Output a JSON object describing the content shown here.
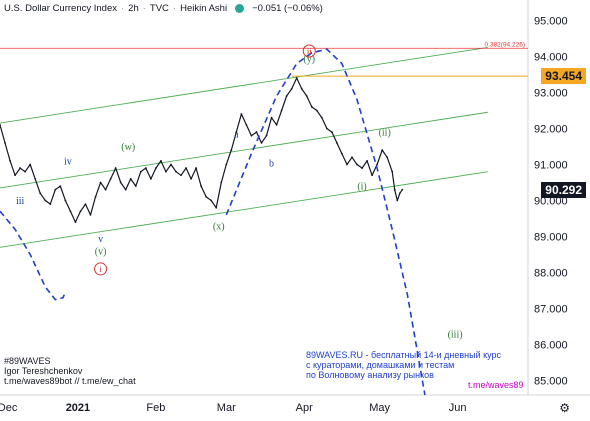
{
  "header": {
    "symbol": "U.S. Dollar Currency Index",
    "interval": "2h",
    "exchange": "TVC",
    "chart_style": "Heikin Ashi",
    "change": "−0.051 (−0.06%)"
  },
  "colors": {
    "candle": "#131722",
    "channel": "#4caf50",
    "forecast": "#1e3fcf",
    "fib_line": "#e53935",
    "level_line": "#f5a623",
    "current_badge": "#131722",
    "level_badge": "#f5a623",
    "wave_green": "#2e7d32",
    "wave_blue": "#1a3ea8",
    "wave_red": "#d32f2f",
    "promo_text": "#1e3fcf",
    "link_magenta": "#c400c4"
  },
  "chart_data": {
    "type": "line",
    "title": "U.S. Dollar Currency Index",
    "ylim": [
      84.6,
      95.4
    ],
    "y_ticks": [
      85.0,
      86.0,
      87.0,
      88.0,
      89.0,
      90.0,
      91.0,
      92.0,
      93.0,
      94.0,
      95.0
    ],
    "y_tick_labels": [
      "85.000",
      "86.000",
      "87.000",
      "88.000",
      "89.000",
      "90.000",
      "91.000",
      "92.000",
      "93.000",
      "94.000",
      "95.000"
    ],
    "x_ticks": [
      {
        "label": "Dec",
        "day": 3
      },
      {
        "label": "2021",
        "day": 31
      },
      {
        "label": "Feb",
        "day": 62
      },
      {
        "label": "Mar",
        "day": 90
      },
      {
        "label": "Apr",
        "day": 121
      },
      {
        "label": "May",
        "day": 151
      },
      {
        "label": "Jun",
        "day": 182
      }
    ],
    "xlim_days": [
      0,
      210
    ],
    "price_series": [
      [
        0,
        92.1
      ],
      [
        2,
        91.6
      ],
      [
        4,
        91.1
      ],
      [
        6,
        90.7
      ],
      [
        8,
        90.9
      ],
      [
        10,
        90.8
      ],
      [
        12,
        91.0
      ],
      [
        14,
        90.6
      ],
      [
        16,
        90.2
      ],
      [
        18,
        90.0
      ],
      [
        20,
        89.9
      ],
      [
        22,
        90.3
      ],
      [
        24,
        90.4
      ],
      [
        26,
        90.0
      ],
      [
        28,
        89.7
      ],
      [
        30,
        89.4
      ],
      [
        32,
        89.7
      ],
      [
        34,
        89.9
      ],
      [
        36,
        89.6
      ],
      [
        38,
        90.1
      ],
      [
        40,
        90.5
      ],
      [
        42,
        90.3
      ],
      [
        44,
        90.6
      ],
      [
        46,
        90.9
      ],
      [
        48,
        90.5
      ],
      [
        50,
        90.3
      ],
      [
        52,
        90.6
      ],
      [
        54,
        90.4
      ],
      [
        56,
        90.8
      ],
      [
        58,
        90.9
      ],
      [
        60,
        90.6
      ],
      [
        62,
        90.9
      ],
      [
        64,
        91.1
      ],
      [
        66,
        90.8
      ],
      [
        68,
        91.0
      ],
      [
        70,
        90.8
      ],
      [
        72,
        90.7
      ],
      [
        74,
        90.9
      ],
      [
        76,
        90.6
      ],
      [
        78,
        90.9
      ],
      [
        80,
        90.4
      ],
      [
        82,
        90.1
      ],
      [
        84,
        90.0
      ],
      [
        86,
        89.8
      ],
      [
        88,
        90.5
      ],
      [
        90,
        91.0
      ],
      [
        92,
        91.4
      ],
      [
        94,
        91.9
      ],
      [
        96,
        92.4
      ],
      [
        98,
        92.1
      ],
      [
        100,
        91.8
      ],
      [
        102,
        91.9
      ],
      [
        104,
        91.6
      ],
      [
        106,
        91.8
      ],
      [
        108,
        92.3
      ],
      [
        110,
        92.1
      ],
      [
        112,
        92.5
      ],
      [
        114,
        92.9
      ],
      [
        116,
        93.1
      ],
      [
        118,
        93.4
      ],
      [
        120,
        93.1
      ],
      [
        122,
        92.9
      ],
      [
        124,
        92.6
      ],
      [
        126,
        92.5
      ],
      [
        128,
        92.3
      ],
      [
        130,
        92.0
      ],
      [
        132,
        91.9
      ],
      [
        134,
        91.6
      ],
      [
        136,
        91.3
      ],
      [
        138,
        91.0
      ],
      [
        140,
        91.2
      ],
      [
        142,
        91.0
      ],
      [
        144,
        90.9
      ],
      [
        146,
        91.1
      ],
      [
        148,
        90.7
      ],
      [
        150,
        91.0
      ],
      [
        152,
        91.4
      ],
      [
        154,
        91.2
      ],
      [
        156,
        90.8
      ],
      [
        157,
        90.3
      ],
      [
        158,
        90.0
      ],
      [
        159,
        90.2
      ],
      [
        160,
        90.3
      ]
    ],
    "channel_lines": [
      {
        "d1": 0,
        "p1": 92.15,
        "d2": 194,
        "p2": 94.25
      },
      {
        "d1": 0,
        "p1": 88.7,
        "d2": 194,
        "p2": 90.8
      },
      {
        "d1": 0,
        "p1": 90.35,
        "d2": 194,
        "p2": 92.45
      }
    ],
    "fib_level": {
      "label": "0.382(94.226)",
      "value": 94.226
    },
    "horizontal_level": {
      "value": 93.454,
      "start_day": 116
    },
    "current_price": 90.292,
    "forecast_paths": [
      [
        [
          0,
          89.7
        ],
        [
          6,
          89.2
        ],
        [
          12,
          88.5
        ],
        [
          18,
          87.6
        ],
        [
          22,
          87.25
        ],
        [
          25,
          87.3
        ],
        [
          26,
          87.45
        ]
      ],
      [
        [
          90,
          89.6
        ],
        [
          100,
          91.3
        ],
        [
          110,
          92.9
        ],
        [
          118,
          93.8
        ],
        [
          124,
          94.1
        ],
        [
          130,
          94.2
        ],
        [
          136,
          93.8
        ],
        [
          142,
          92.8
        ],
        [
          150,
          90.9
        ],
        [
          156,
          89.2
        ],
        [
          162,
          87.4
        ],
        [
          166,
          85.8
        ],
        [
          169,
          84.6
        ]
      ]
    ],
    "wave_labels": [
      {
        "text": "iii",
        "day": 8,
        "price": 89.9,
        "color": "blue"
      },
      {
        "text": "iv",
        "day": 27,
        "price": 91.0,
        "color": "blue"
      },
      {
        "text": "(w)",
        "day": 51,
        "price": 91.4,
        "color": "green"
      },
      {
        "text": "v",
        "day": 40,
        "price": 88.85,
        "color": "blue"
      },
      {
        "text": "(v)",
        "day": 40,
        "price": 88.5,
        "color": "green"
      },
      {
        "text": "(x)",
        "day": 87,
        "price": 89.2,
        "color": "green"
      },
      {
        "text": "a",
        "day": 94,
        "price": 91.75,
        "color": "blue"
      },
      {
        "text": "b",
        "day": 108,
        "price": 90.95,
        "color": "blue"
      },
      {
        "text": "(y)",
        "day": 123,
        "price": 93.85,
        "color": "green"
      },
      {
        "text": "(i)",
        "day": 144,
        "price": 90.3,
        "color": "green"
      },
      {
        "text": "(ii)",
        "day": 153,
        "price": 91.8,
        "color": "green"
      },
      {
        "text": "(iii)",
        "day": 181,
        "price": 86.2,
        "color": "green"
      }
    ],
    "circled_labels": [
      {
        "text": "i",
        "day": 40,
        "price": 88.1
      },
      {
        "text": "ii",
        "day": 123,
        "price": 94.15
      }
    ],
    "grid": false
  },
  "author": {
    "lines": [
      "#89WAVES",
      "Igor Tereshchenkov",
      "t.me/waves89bot // t.me/ew_chat"
    ]
  },
  "promo": {
    "lines": [
      "89WAVES.RU - бесплатный 14-и дневный курс",
      "с кураторами, домашками и тестам",
      "по Волновому анализу рынков"
    ],
    "link": "t.me/waves89"
  },
  "ui": {
    "price_badge_current": "90.292",
    "price_badge_level": "93.454",
    "settings_icon": "gear-icon"
  }
}
